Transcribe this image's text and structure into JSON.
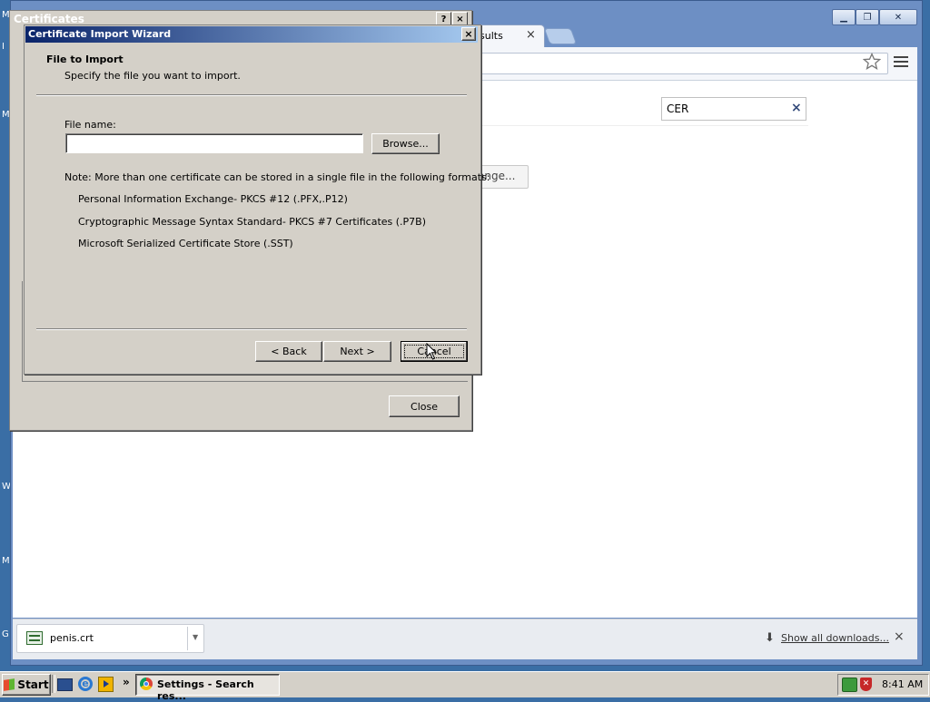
{
  "desktop": {
    "side_letters": [
      "M",
      "I",
      "M",
      "W",
      "M",
      "G"
    ]
  },
  "chrome": {
    "tab_title": "sults",
    "tab_close": "×",
    "search_value": "CER",
    "search_clear": "×",
    "change_button": "ange...",
    "download": {
      "filename": "penis.crt",
      "show_all": "Show all downloads...",
      "close": "×"
    }
  },
  "certificates": {
    "title": "Certificates",
    "help": "?",
    "close": "×",
    "close_button": "Close"
  },
  "wizard": {
    "title": "Certificate Import Wizard",
    "close": "×",
    "heading": "File to Import",
    "subheading": "Specify the file you want to import.",
    "file_label": "File name:",
    "file_value": "",
    "browse": "Browse...",
    "note": "Note:  More than one certificate can be stored in a single file in the following formats:",
    "formats": [
      "Personal Information Exchange- PKCS #12 (.PFX,.P12)",
      "Cryptographic Message Syntax Standard- PKCS #7 Certificates (.P7B)",
      "Microsoft Serialized Certificate Store (.SST)"
    ],
    "back": "< Back",
    "next": "Next >",
    "cancel": "Cancel"
  },
  "taskbar": {
    "start": "Start",
    "chevron": "»",
    "task_label": "Settings - Search res...",
    "clock": "8:41 AM"
  },
  "icons": [
    "windows-flag-icon",
    "show-desktop-icon",
    "ie-icon",
    "media-player-icon",
    "chrome-icon",
    "network-icon",
    "shield-icon",
    "star-icon",
    "menu-icon",
    "download-arrow-icon",
    "file-icon",
    "mouse-cursor-icon"
  ]
}
